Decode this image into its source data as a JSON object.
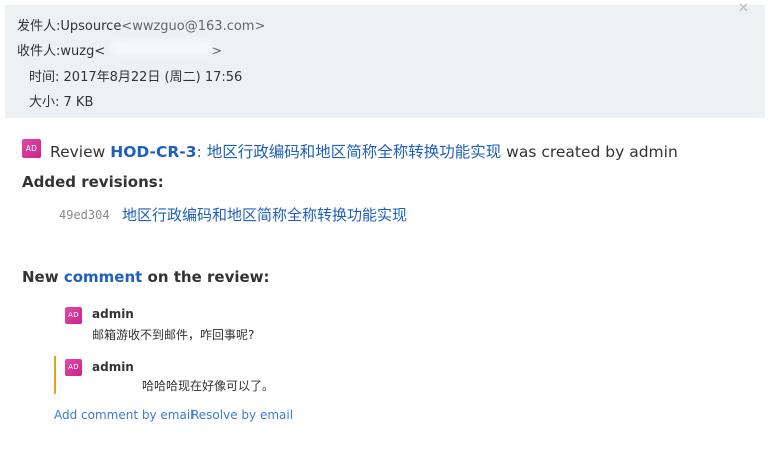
{
  "header": {
    "from_label": "发件人:",
    "from_name": "Upsource",
    "from_email": "<wwzguo@163.com>",
    "to_label": "收件人:",
    "to_name": "wuzg<",
    "to_tail": ">",
    "time_label": "时间:",
    "time_value": "2017年8月22日 (周二) 17:56",
    "size_label": "大小:",
    "size_value": "7 KB",
    "close_glyph": "✕"
  },
  "review": {
    "avatar_initials": "AD",
    "prefix": "Review",
    "id": "HOD-CR-3",
    "colon": ":",
    "title": "地区行政编码和地区简称全称转换功能实现",
    "suffix": "was created by admin"
  },
  "revisions": {
    "heading": "Added revisions:",
    "items": [
      {
        "hash": "49ed304",
        "message": "地区行政编码和地区简称全称转换功能实现"
      }
    ]
  },
  "comments": {
    "heading_prefix": "New",
    "heading_link": "comment",
    "heading_suffix": "on the review:",
    "items": [
      {
        "avatar_initials": "AD",
        "author": "admin",
        "text": "邮箱游收不到邮件，咋回事呢?"
      },
      {
        "avatar_initials": "AD",
        "author": "admin",
        "text": "哈哈哈现在好像可以了。"
      }
    ]
  },
  "actions": {
    "add_comment": "Add comment by email",
    "resolve": "Resolve by email"
  }
}
